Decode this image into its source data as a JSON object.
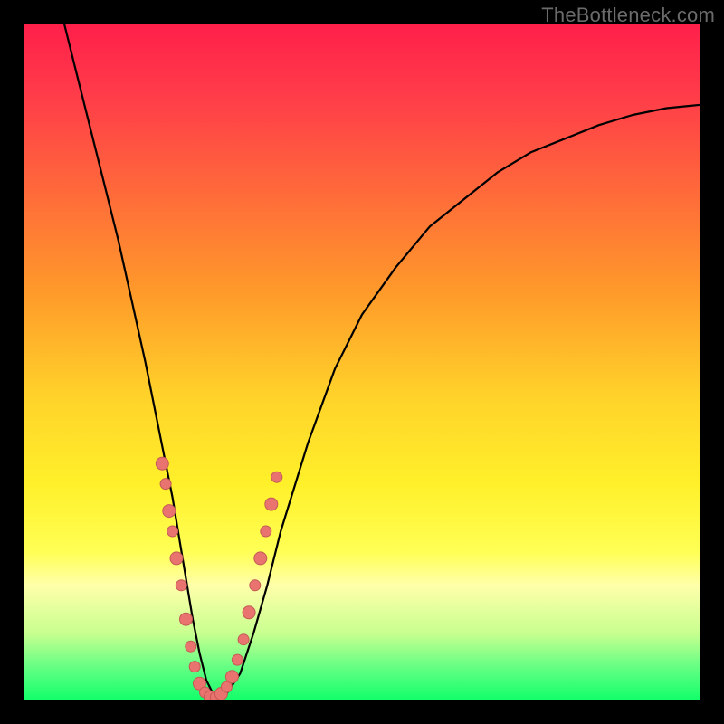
{
  "watermark": "TheBottleneck.com",
  "colors": {
    "frame": "#000000",
    "gradient_stops": [
      {
        "offset": 0.0,
        "color": "#ff1f4a"
      },
      {
        "offset": 0.1,
        "color": "#ff3a4a"
      },
      {
        "offset": 0.25,
        "color": "#ff6a3a"
      },
      {
        "offset": 0.4,
        "color": "#ff9b2a"
      },
      {
        "offset": 0.55,
        "color": "#ffd22a"
      },
      {
        "offset": 0.68,
        "color": "#fff02a"
      },
      {
        "offset": 0.78,
        "color": "#ffff55"
      },
      {
        "offset": 0.83,
        "color": "#ffffaa"
      },
      {
        "offset": 0.9,
        "color": "#c9ff90"
      },
      {
        "offset": 0.95,
        "color": "#66ff84"
      },
      {
        "offset": 1.0,
        "color": "#11ff6a"
      }
    ],
    "curve": "#000000",
    "dot_fill": "#e9746f",
    "dot_stroke": "#c45a55"
  },
  "chart_data": {
    "type": "line",
    "title": "",
    "xlabel": "",
    "ylabel": "",
    "xlim": [
      0,
      100
    ],
    "ylim": [
      0,
      100
    ],
    "grid": false,
    "legend": false,
    "series": [
      {
        "name": "bottleneck-curve",
        "x": [
          6,
          8,
          10,
          12,
          14,
          16,
          18,
          20,
          22,
          23,
          24,
          25,
          26,
          27,
          28,
          29,
          30,
          32,
          34,
          36,
          38,
          42,
          46,
          50,
          55,
          60,
          65,
          70,
          75,
          80,
          85,
          90,
          95,
          100
        ],
        "y": [
          100,
          92,
          84,
          76,
          68,
          59,
          50,
          40,
          30,
          24,
          18,
          12,
          7,
          3,
          1,
          0,
          1,
          4,
          10,
          17,
          25,
          38,
          49,
          57,
          64,
          70,
          74,
          78,
          81,
          83,
          85,
          86.5,
          87.5,
          88
        ]
      }
    ],
    "scatter": {
      "name": "highlight-dots",
      "points": [
        {
          "x": 20.5,
          "y": 35,
          "r": 7
        },
        {
          "x": 21.0,
          "y": 32,
          "r": 6
        },
        {
          "x": 21.5,
          "y": 28,
          "r": 7
        },
        {
          "x": 22.0,
          "y": 25,
          "r": 6
        },
        {
          "x": 22.6,
          "y": 21,
          "r": 7
        },
        {
          "x": 23.3,
          "y": 17,
          "r": 6
        },
        {
          "x": 24.0,
          "y": 12,
          "r": 7
        },
        {
          "x": 24.7,
          "y": 8,
          "r": 6
        },
        {
          "x": 25.3,
          "y": 5,
          "r": 6
        },
        {
          "x": 26.0,
          "y": 2.5,
          "r": 7
        },
        {
          "x": 26.8,
          "y": 1.2,
          "r": 6
        },
        {
          "x": 27.6,
          "y": 0.5,
          "r": 7
        },
        {
          "x": 28.4,
          "y": 0.5,
          "r": 6
        },
        {
          "x": 29.2,
          "y": 1.0,
          "r": 7
        },
        {
          "x": 30.0,
          "y": 2.0,
          "r": 6
        },
        {
          "x": 30.8,
          "y": 3.5,
          "r": 7
        },
        {
          "x": 31.6,
          "y": 6,
          "r": 6
        },
        {
          "x": 32.5,
          "y": 9,
          "r": 6
        },
        {
          "x": 33.3,
          "y": 13,
          "r": 7
        },
        {
          "x": 34.2,
          "y": 17,
          "r": 6
        },
        {
          "x": 35.0,
          "y": 21,
          "r": 7
        },
        {
          "x": 35.8,
          "y": 25,
          "r": 6
        },
        {
          "x": 36.6,
          "y": 29,
          "r": 7
        },
        {
          "x": 37.4,
          "y": 33,
          "r": 6
        }
      ]
    }
  }
}
